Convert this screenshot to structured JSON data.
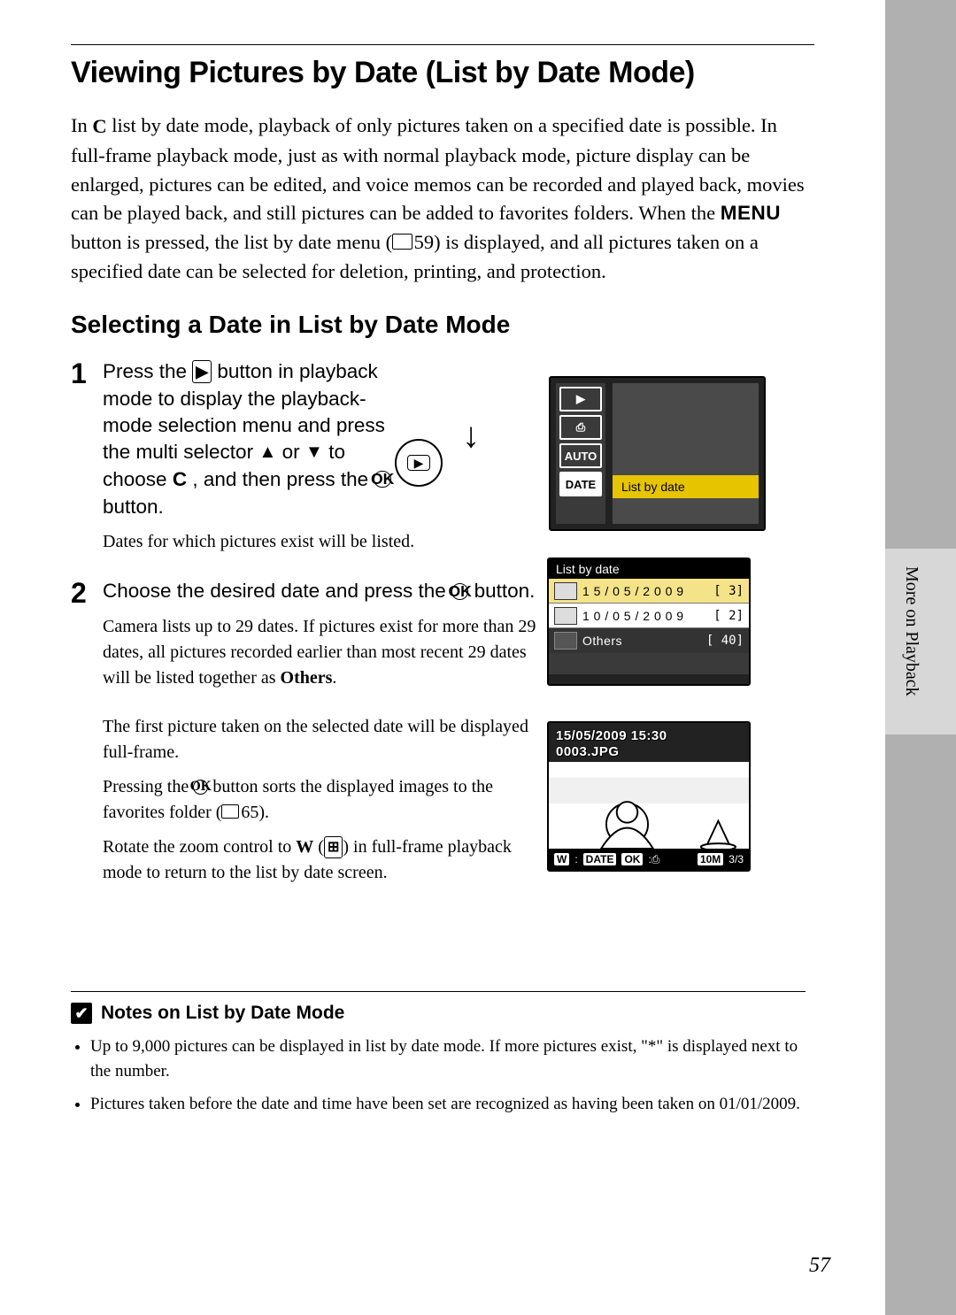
{
  "page_number": "57",
  "side_tab": "More on Playback",
  "title": "Viewing Pictures by Date (List by Date Mode)",
  "intro": {
    "pre_icon": "In ",
    "mode_icon_label": "C",
    "part1": " list by date mode, playback of only pictures taken on a specified date is possible. In full-frame playback mode, just as with normal playback mode, picture display can be enlarged, pictures can be edited, and voice memos can be recorded and played back, movies can be played back, and still pictures can be added to favorites folders. When the ",
    "menu_word": "MENU",
    "part2": " button is pressed, the list by date menu (",
    "page_ref": "59",
    "part3": ") is displayed, and all pictures taken on a specified date can be selected for deletion, printing, and protection."
  },
  "subhead": "Selecting a Date in List by Date Mode",
  "step1": {
    "num": "1",
    "a": "Press the ",
    "play_glyph": "▶",
    "b": " button in playback mode to display the playback-mode selection menu and press the multi selector ",
    "up": "▲",
    "c": " or ",
    "down": "▼",
    "d": " to choose ",
    "mode": "C",
    "e": " , and then press the ",
    "ok": "OK",
    "f": " button.",
    "note": "Dates for which pictures exist will be listed."
  },
  "step2": {
    "num": "2",
    "a": "Choose the desired date and press the ",
    "ok": "OK",
    "b": " button.",
    "note1_a": "Camera lists up to 29 dates. If pictures exist for more than 29 dates, all pictures recorded earlier than most recent 29 dates will be listed together as ",
    "note1_bold": "Others",
    "note1_b": ".",
    "note2": "The first picture taken on the selected date will be displayed full-frame.",
    "note3_a": "Pressing the ",
    "note3_ok": "OK",
    "note3_b": " button sorts the displayed images to the favorites folder (",
    "note3_ref": "65",
    "note3_c": ").",
    "note4_a": "Rotate the zoom control to ",
    "note4_w": "W",
    "note4_thumb": "⊞",
    "note4_b": " in full-frame playback mode to return to the list by date screen."
  },
  "fig1": {
    "icons": [
      "▶",
      "⎙",
      "AUTO",
      "DATE"
    ],
    "selected_index": 3,
    "highlight_label": "List by date"
  },
  "fig2": {
    "title": "List by date",
    "rows": [
      {
        "date": "1 5 / 0 5 / 2 0 0 9",
        "count": "3",
        "selected": true
      },
      {
        "date": "1 0 / 0 5 / 2 0 0 9",
        "count": "2",
        "selected": false
      }
    ],
    "others_label": "Others",
    "others_count": "40"
  },
  "fig3": {
    "timestamp": "15/05/2009 15:30",
    "filename": "0003.JPG",
    "bottom_tags": {
      "w": "W",
      "date": "DATE",
      "ok": "OK"
    },
    "counter": "3/",
    "total": "3",
    "size_badge": "10M"
  },
  "notes": {
    "heading": "Notes on List by Date Mode",
    "items": [
      "Up to 9,000 pictures can be displayed in list by date mode. If more pictures exist, \"*\" is displayed next to the number.",
      "Pictures taken before the date and time have been set are recognized as having been taken on 01/01/2009."
    ]
  }
}
